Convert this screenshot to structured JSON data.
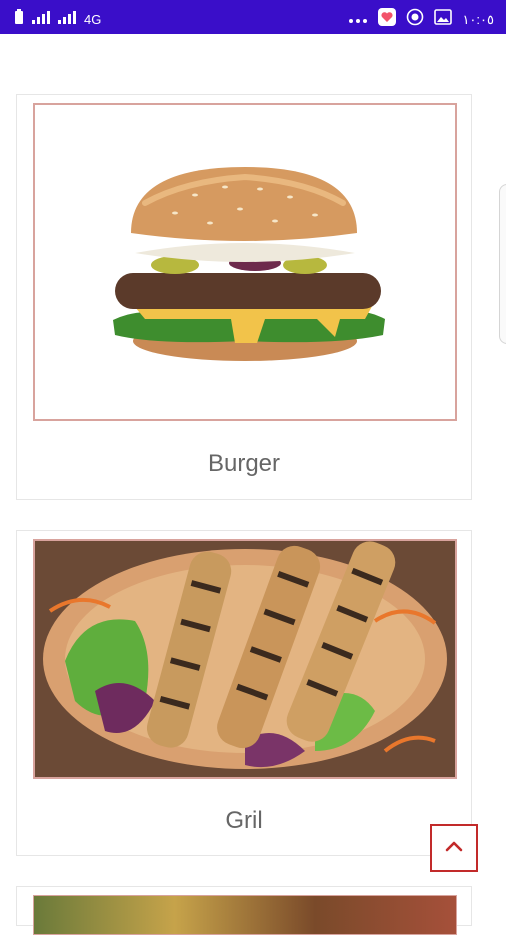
{
  "status_bar": {
    "network_label": "4G",
    "time": "١٠:٠٥"
  },
  "cards": [
    {
      "label": "Burger",
      "image": "burger-photo"
    },
    {
      "label": "Gril",
      "image": "grilled-skewers-photo"
    },
    {
      "label": "",
      "image": "food-photo-partial"
    }
  ],
  "icons": {
    "scroll_top": "chevron-up-icon"
  },
  "colors": {
    "status_bar": "#3a0ec9",
    "accent": "#c22a2a",
    "frame_border": "#d8a39d",
    "label_text": "#666666"
  }
}
